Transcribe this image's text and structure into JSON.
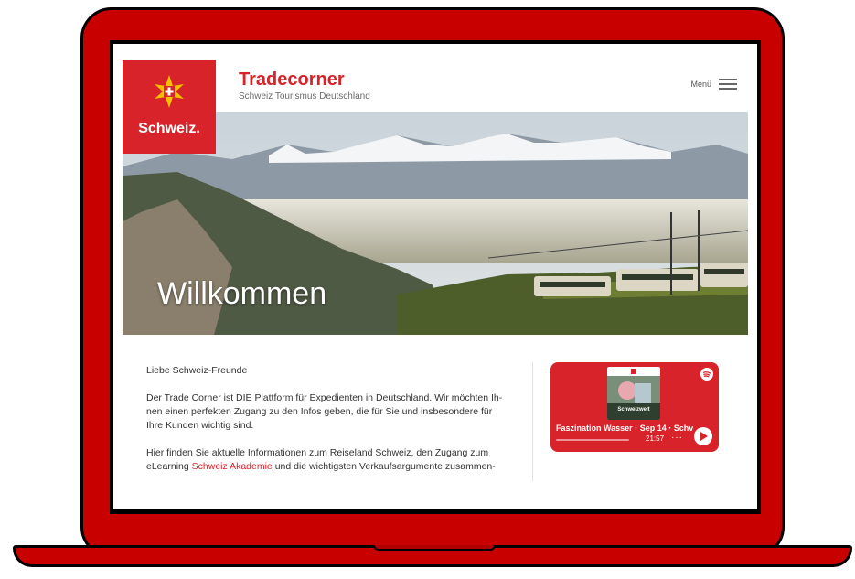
{
  "brand": {
    "logo_text": "Schweiz.",
    "title": "Tradecorner",
    "subtitle": "Schweiz Tourismus Deutschland",
    "accent": "#d8232a",
    "frame_color": "#c80000"
  },
  "header": {
    "menu_label": "Menü",
    "menu_icon": "hamburger-icon"
  },
  "hero": {
    "title": "Willkommen"
  },
  "content": {
    "greeting": "Liebe Schweiz-Freunde",
    "paragraph1": "Der Trade Corner ist DIE Plattform für Expedienten in Deutschland. Wir möchten Ih-nen einen perfekten Zugang zu den Infos geben, die für Sie und insbesondere für Ihre Kunden wichtig sind.",
    "paragraph2_start": "Hier finden Sie aktuelle Informationen zum Reiseland Schweiz, den Zugang zum eLearning",
    "paragraph2_link": "Schweiz Akademie",
    "paragraph2_end": "und die wichtigsten Verkaufsargumente zusammen-"
  },
  "podcast": {
    "cover_text": "Schweizwelt",
    "title": "Faszination Wasser · Sep 14 · Schv",
    "duration": "21:57",
    "more": "···",
    "progress": 0.0
  }
}
